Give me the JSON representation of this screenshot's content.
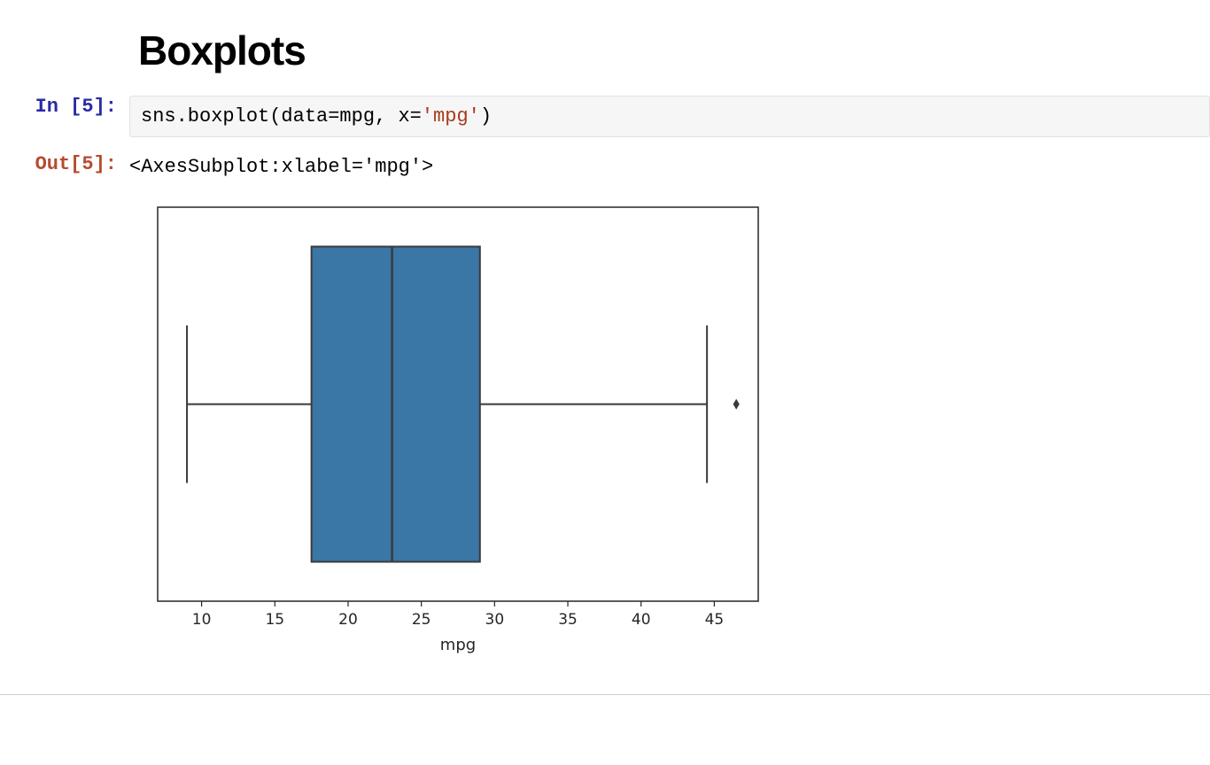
{
  "heading": "Boxplots",
  "cell": {
    "in_prompt": "In [5]:",
    "out_prompt": "Out[5]:",
    "code_prefix": "sns.boxplot(data=mpg, x=",
    "code_str": "'mpg'",
    "code_suffix": ")",
    "out_text": "<AxesSubplot:xlabel='mpg'>"
  },
  "chart_data": {
    "type": "boxplot",
    "orientation": "horizontal",
    "xlabel": "mpg",
    "xticks": [
      10,
      15,
      20,
      25,
      30,
      35,
      40,
      45
    ],
    "xlim": [
      7,
      48
    ],
    "whisker_low": 9,
    "q1": 17.5,
    "median": 23,
    "q3": 29,
    "whisker_high": 44.5,
    "outliers": [
      46.5
    ],
    "box_color": "#3a76a6",
    "box_edge": "#3a3a3a"
  }
}
